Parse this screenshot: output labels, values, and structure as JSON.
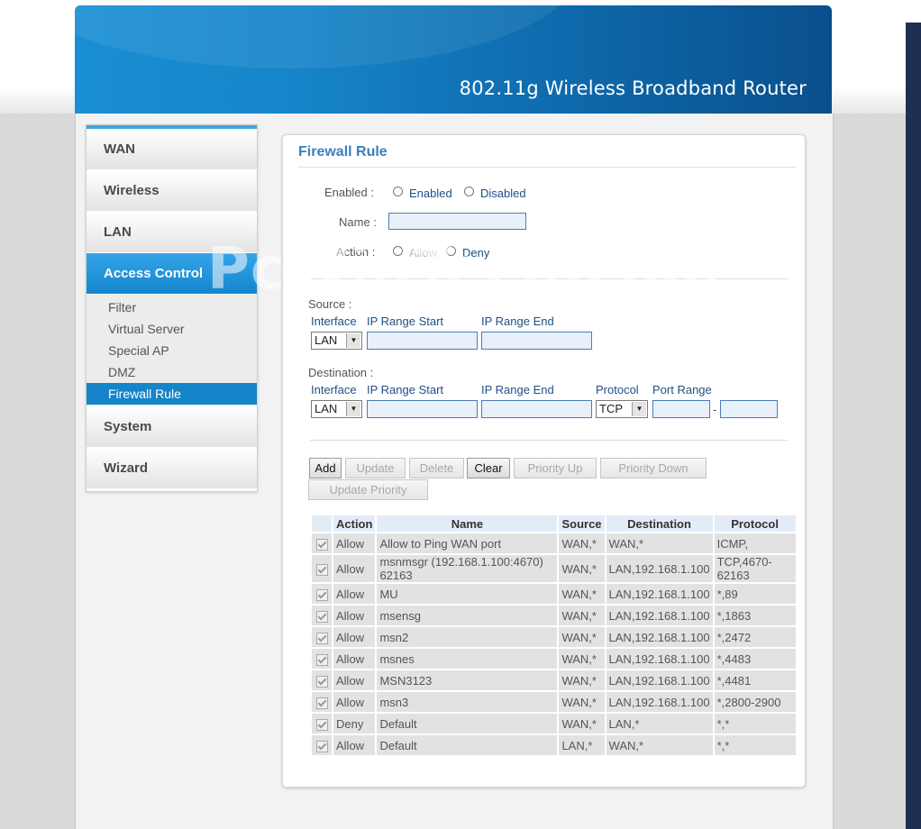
{
  "header": {
    "title": "802.11g Wireless Broadband Router"
  },
  "sidebar": {
    "items": [
      {
        "label": "WAN"
      },
      {
        "label": "Wireless"
      },
      {
        "label": "LAN"
      },
      {
        "label": "Access Control"
      },
      {
        "label": "System"
      },
      {
        "label": "Wizard"
      }
    ],
    "sub_items": [
      {
        "label": "Filter"
      },
      {
        "label": "Virtual Server"
      },
      {
        "label": "Special AP"
      },
      {
        "label": "DMZ"
      },
      {
        "label": "Firewall Rule"
      }
    ]
  },
  "panel": {
    "title": "Firewall Rule",
    "enabled_label": "Enabled :",
    "enabled_opt": "Enabled",
    "disabled_opt": "Disabled",
    "name_label": "Name :",
    "name_value": "",
    "action_label": "Action :",
    "allow_opt": "Allow",
    "deny_opt": "Deny",
    "source": {
      "heading": "Source :",
      "interface_label": "Interface",
      "ip_start_label": "IP Range Start",
      "ip_end_label": "IP Range End",
      "interface_value": "LAN"
    },
    "destination": {
      "heading": "Destination :",
      "interface_label": "Interface",
      "ip_start_label": "IP Range Start",
      "ip_end_label": "IP Range End",
      "protocol_label": "Protocol",
      "port_range_label": "Port Range",
      "interface_value": "LAN",
      "protocol_value": "TCP",
      "port_sep": "-"
    },
    "buttons": {
      "add": "Add",
      "update": "Update",
      "delete": "Delete",
      "clear": "Clear",
      "priority_up": "Priority Up",
      "priority_down": "Priority Down",
      "update_priority": "Update Priority"
    },
    "table": {
      "headers": [
        "Action",
        "Name",
        "Source",
        "Destination",
        "Protocol"
      ],
      "rows": [
        {
          "action": "Allow",
          "name": "Allow to Ping WAN port",
          "source": "WAN,*",
          "destination": "WAN,*",
          "protocol": "ICMP,"
        },
        {
          "action": "Allow",
          "name": "msnmsgr (192.168.1.100:4670) 62163",
          "source": "WAN,*",
          "destination": "LAN,192.168.1.100",
          "protocol": "TCP,4670-62163"
        },
        {
          "action": "Allow",
          "name": "MU",
          "source": "WAN,*",
          "destination": "LAN,192.168.1.100",
          "protocol": "*,89"
        },
        {
          "action": "Allow",
          "name": "msensg",
          "source": "WAN,*",
          "destination": "LAN,192.168.1.100",
          "protocol": "*,1863"
        },
        {
          "action": "Allow",
          "name": "msn2",
          "source": "WAN,*",
          "destination": "LAN,192.168.1.100",
          "protocol": "*,2472"
        },
        {
          "action": "Allow",
          "name": "msnes",
          "source": "WAN,*",
          "destination": "LAN,192.168.1.100",
          "protocol": "*,4483"
        },
        {
          "action": "Allow",
          "name": "MSN3123",
          "source": "WAN,*",
          "destination": "LAN,192.168.1.100",
          "protocol": "*,4481"
        },
        {
          "action": "Allow",
          "name": "msn3",
          "source": "WAN,*",
          "destination": "LAN,192.168.1.100",
          "protocol": "*,2800-2900"
        },
        {
          "action": "Deny",
          "name": "Default",
          "source": "WAN,*",
          "destination": "LAN,*",
          "protocol": "*,*"
        },
        {
          "action": "Allow",
          "name": "Default",
          "source": "LAN,*",
          "destination": "WAN,*",
          "protocol": "*,*"
        }
      ]
    }
  },
  "watermark": "PcWinTech.com"
}
